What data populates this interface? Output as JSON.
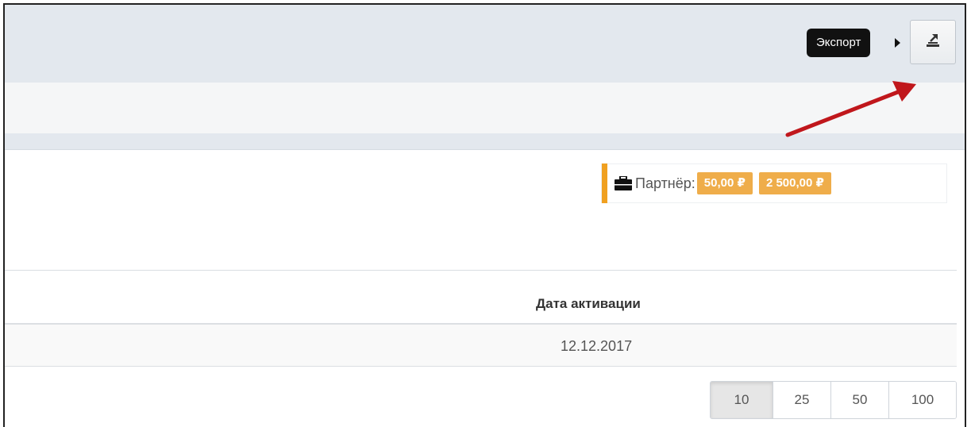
{
  "toolbar": {
    "tooltip_text": "Экспорт",
    "export_icon": "export-icon"
  },
  "partner": {
    "icon": "briefcase-icon",
    "label": "Партнёр:",
    "amount1": "50,00 ₽",
    "amount2": "2 500,00 ₽",
    "accent_color": "#f0a020",
    "badge_color": "#efad4a"
  },
  "table": {
    "columns": [
      "Дата активации"
    ],
    "rows": [
      {
        "activation_date": "12.12.2017"
      }
    ]
  },
  "pagination": {
    "options": [
      "10",
      "25",
      "50",
      "100"
    ],
    "selected": "10"
  },
  "annotation": {
    "arrow_color": "#c0171c"
  }
}
